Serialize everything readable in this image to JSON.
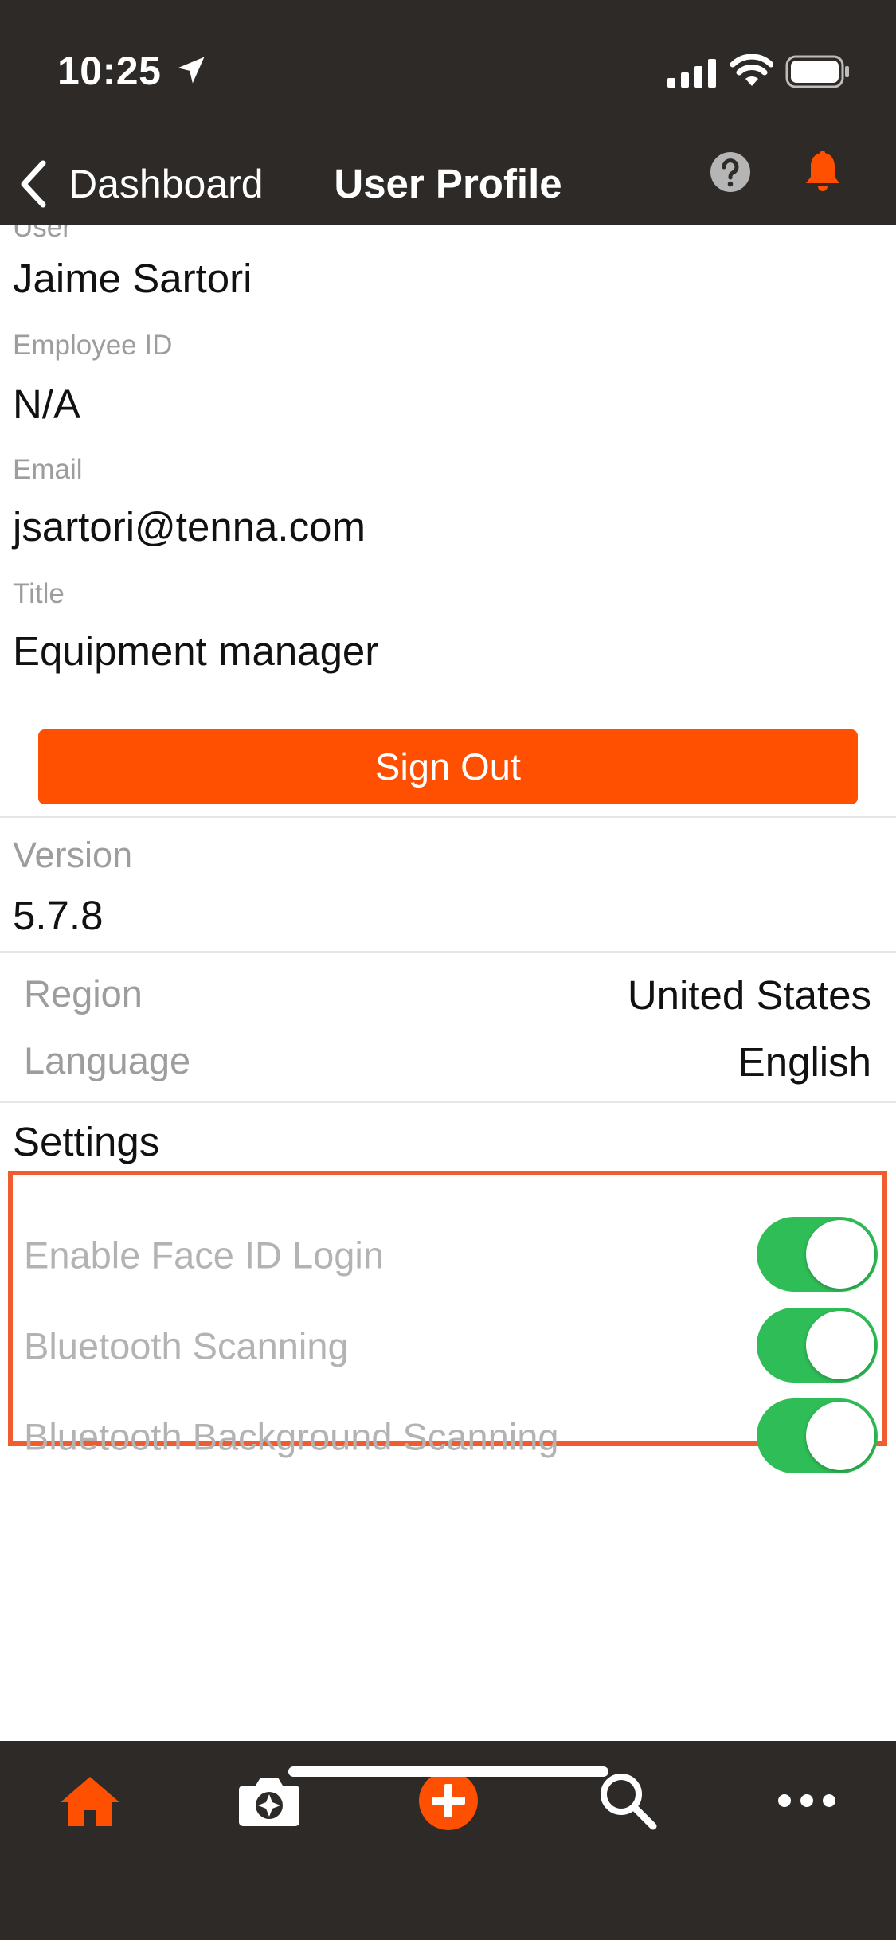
{
  "status_bar": {
    "time": "10:25"
  },
  "nav": {
    "back_label": "Dashboard",
    "title": "User Profile"
  },
  "profile": {
    "user_label": "User",
    "user_name": "Jaime Sartori",
    "employee_id_label": "Employee ID",
    "employee_id": "N/A",
    "email_label": "Email",
    "email": "jsartori@tenna.com",
    "title_label": "Title",
    "title": "Equipment manager"
  },
  "sign_out_label": "Sign Out",
  "version": {
    "label": "Version",
    "value": "5.7.8"
  },
  "preferences": {
    "region_label": "Region",
    "region_value": "United States",
    "language_label": "Language",
    "language_value": "English"
  },
  "settings": {
    "heading": "Settings",
    "items": [
      {
        "label": "Enable Face ID Login",
        "enabled": true
      },
      {
        "label": "Bluetooth Scanning",
        "enabled": true
      },
      {
        "label": "Bluetooth Background Scanning",
        "enabled": true
      }
    ]
  },
  "tabbar": {
    "tabs": [
      "home-icon",
      "camera-icon",
      "add-icon",
      "search-icon",
      "more-icon"
    ]
  },
  "colors": {
    "bar_background": "#2d2a27",
    "accent": "#fe5000",
    "toggle_on": "#2ebd56",
    "highlight": "#f15b30"
  }
}
